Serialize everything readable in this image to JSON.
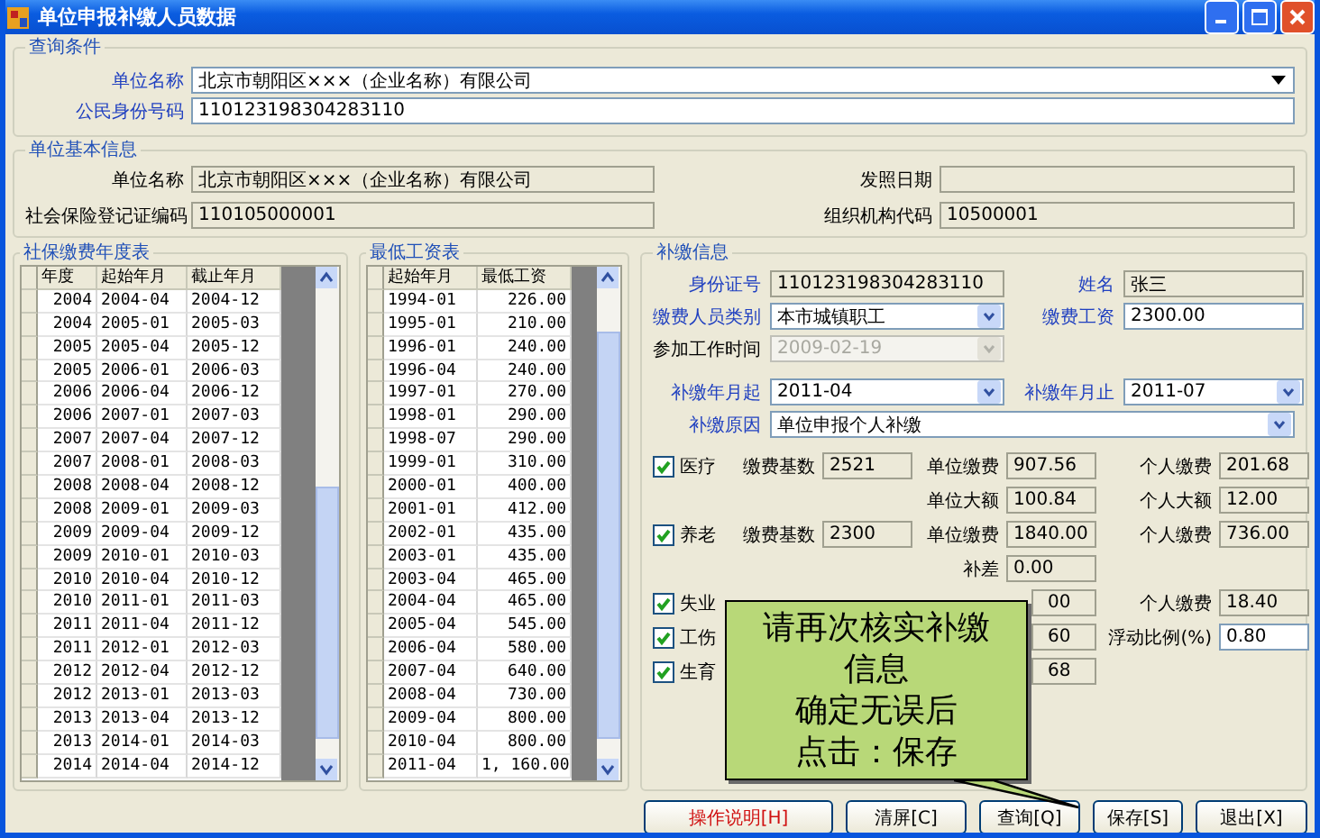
{
  "window": {
    "title": "单位申报补缴人员数据"
  },
  "query": {
    "title": "查询条件",
    "fields": [
      {
        "label": "单位名称",
        "value": "北京市朝阳区×××（企业名称）有限公司",
        "kind": "combo"
      },
      {
        "label": "公民身份号码",
        "value": "110123198304283110",
        "kind": "text"
      }
    ]
  },
  "unit_info": {
    "title": "单位基本信息",
    "fields": [
      {
        "label": "单位名称",
        "value": "北京市朝阳区×××（企业名称）有限公司"
      },
      {
        "label": "发照日期"
      },
      {
        "label": "社会保险登记证编码",
        "value": "110105000001"
      },
      {
        "label": "组织机构代码",
        "value": "10500001"
      }
    ]
  },
  "year_table": {
    "title": "社保缴费年度表",
    "columns": [
      "年度",
      "起始年月",
      "截止年月"
    ],
    "rows": [
      [
        "2004",
        "2004-04",
        "2004-12"
      ],
      [
        "2004",
        "2005-01",
        "2005-03"
      ],
      [
        "2005",
        "2005-04",
        "2005-12"
      ],
      [
        "2005",
        "2006-01",
        "2006-03"
      ],
      [
        "2006",
        "2006-04",
        "2006-12"
      ],
      [
        "2006",
        "2007-01",
        "2007-03"
      ],
      [
        "2007",
        "2007-04",
        "2007-12"
      ],
      [
        "2007",
        "2008-01",
        "2008-03"
      ],
      [
        "2008",
        "2008-04",
        "2008-12"
      ],
      [
        "2008",
        "2009-01",
        "2009-03"
      ],
      [
        "2009",
        "2009-04",
        "2009-12"
      ],
      [
        "2009",
        "2010-01",
        "2010-03"
      ],
      [
        "2010",
        "2010-04",
        "2010-12"
      ],
      [
        "2010",
        "2011-01",
        "2011-03"
      ],
      [
        "2011",
        "2011-04",
        "2011-12"
      ],
      [
        "2011",
        "2012-01",
        "2012-03"
      ],
      [
        "2012",
        "2012-04",
        "2012-12"
      ],
      [
        "2012",
        "2013-01",
        "2013-03"
      ],
      [
        "2013",
        "2013-04",
        "2013-12"
      ],
      [
        "2013",
        "2014-01",
        "2014-03"
      ],
      [
        "2014",
        "2014-04",
        "2014-12"
      ]
    ]
  },
  "wage_table": {
    "title": "最低工资表",
    "columns": [
      "起始年月",
      "最低工资"
    ],
    "rows": [
      [
        "1994-01",
        "226.00"
      ],
      [
        "1995-01",
        "210.00"
      ],
      [
        "1996-01",
        "240.00"
      ],
      [
        "1996-04",
        "240.00"
      ],
      [
        "1997-01",
        "270.00"
      ],
      [
        "1998-01",
        "290.00"
      ],
      [
        "1998-07",
        "290.00"
      ],
      [
        "1999-01",
        "310.00"
      ],
      [
        "2000-01",
        "400.00"
      ],
      [
        "2001-01",
        "412.00"
      ],
      [
        "2002-01",
        "435.00"
      ],
      [
        "2003-01",
        "435.00"
      ],
      [
        "2003-04",
        "465.00"
      ],
      [
        "2004-04",
        "465.00"
      ],
      [
        "2005-04",
        "545.00"
      ],
      [
        "2006-04",
        "580.00"
      ],
      [
        "2007-04",
        "640.00"
      ],
      [
        "2008-04",
        "730.00"
      ],
      [
        "2009-04",
        "800.00"
      ],
      [
        "2010-04",
        "800.00"
      ],
      [
        "2011-04",
        "1, 160.00"
      ]
    ]
  },
  "supplement": {
    "title": "补缴信息",
    "id": {
      "label": "身份证号",
      "value": "110123198304283110"
    },
    "name": {
      "label": "姓名",
      "value": "张三"
    },
    "category": {
      "label": "缴费人员类别",
      "value": "本市城镇职工"
    },
    "wage": {
      "label": "缴费工资",
      "value": "2300.00"
    },
    "work_start": {
      "label": "参加工作时间",
      "value": "2009-02-19",
      "disabled": true
    },
    "from": {
      "label": "补缴年月起",
      "value": "2011-04"
    },
    "to": {
      "label": "补缴年月止",
      "value": "2011-07"
    },
    "reason": {
      "label": "补缴原因",
      "value": "单位申报个人补缴"
    },
    "insurance_rows": [
      {
        "check": {
          "label": "医疗",
          "checked": true
        },
        "cells": [
          {
            "label": "缴费基数",
            "value": "2521"
          },
          {
            "label": "单位缴费",
            "value": "907.56"
          },
          {
            "label": "个人缴费",
            "value": "201.68"
          }
        ]
      },
      {
        "cells": [
          null,
          {
            "label": "单位大额",
            "value": "100.84"
          },
          {
            "label": "个人大额",
            "value": "12.00"
          }
        ]
      },
      {
        "check": {
          "label": "养老",
          "checked": true
        },
        "cells": [
          {
            "label": "缴费基数",
            "value": "2300"
          },
          {
            "label": "单位缴费",
            "value": "1840.00"
          },
          {
            "label": "个人缴费",
            "value": "736.00"
          }
        ]
      },
      {
        "cells": [
          null,
          {
            "label": "补差",
            "value": "0.00"
          },
          null
        ]
      },
      {
        "check": {
          "label": "失业",
          "checked": true
        },
        "cells": [
          null,
          {
            "value": "00",
            "covered": true
          },
          {
            "label": "个人缴费",
            "value": "18.40"
          }
        ]
      },
      {
        "check": {
          "label": "工伤",
          "checked": true
        },
        "cells": [
          null,
          {
            "value": "60",
            "covered": true
          },
          {
            "label": "浮动比例(%)",
            "value": "0.80",
            "editable": true
          }
        ]
      },
      {
        "check": {
          "label": "生育",
          "checked": true
        },
        "cells": [
          null,
          {
            "value": "68",
            "covered": true
          },
          null
        ]
      }
    ]
  },
  "callout": {
    "lines": [
      "请再次核实补缴",
      "信息",
      "确定无误后",
      "点击：保存"
    ]
  },
  "buttons": [
    {
      "label": "操作说明[H]",
      "kind": "help"
    },
    {
      "label": "清屏[C]",
      "kind": "normal"
    },
    {
      "label": "查询[Q]",
      "kind": "normal"
    },
    {
      "label": "保存[S]",
      "kind": "normal"
    },
    {
      "label": "退出[X]",
      "kind": "normal"
    }
  ]
}
